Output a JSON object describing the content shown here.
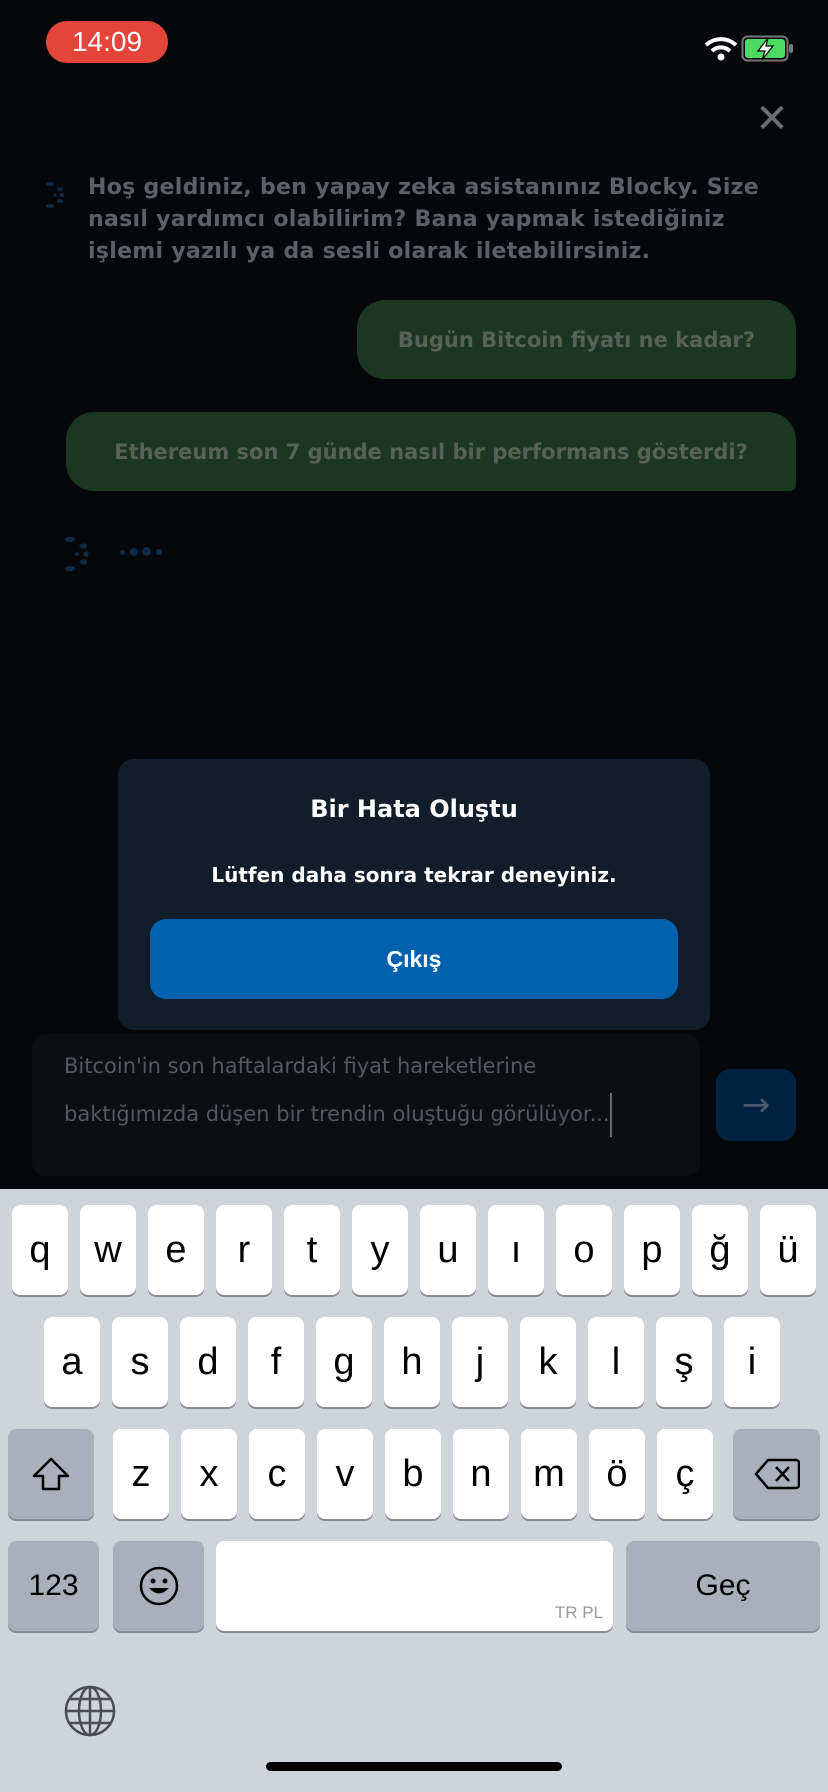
{
  "status_bar": {
    "time": "14:09",
    "wifi_icon": "wifi-icon",
    "battery_icon": "battery-charging-icon",
    "battery_color": "#4cd964"
  },
  "chat": {
    "welcome": "Hoş geldiniz, ben yapay zeka asistanınız Blocky. Size nasıl yardımcı olabilirim? Bana yapmak istediğiniz işlemi yazılı ya da sesli olarak iletebilirsiniz.",
    "messages": [
      "Bugün Bitcoin fiyatı ne kadar?",
      "Ethereum son 7 günde nasıl bir performans gösterdi?"
    ],
    "close_icon": "close-icon"
  },
  "dialog": {
    "title": "Bir Hata Oluştu",
    "message": "Lütfen daha sonra tekrar deneyiniz.",
    "button": "Çıkış"
  },
  "input": {
    "value": "Bitcoin'in son haftalardaki fiyat hareketlerine baktığımızda düşen bir trendin oluştuğu görülüyor...",
    "send_icon": "arrow-right-icon"
  },
  "keyboard": {
    "row1": [
      "q",
      "w",
      "e",
      "r",
      "t",
      "y",
      "u",
      "ı",
      "o",
      "p",
      "ğ",
      "ü"
    ],
    "row2": [
      "a",
      "s",
      "d",
      "f",
      "g",
      "h",
      "j",
      "k",
      "l",
      "ş",
      "i"
    ],
    "row3": [
      "z",
      "x",
      "c",
      "v",
      "b",
      "n",
      "m",
      "ö",
      "ç"
    ],
    "numbers": "123",
    "space_hint": "TR PL",
    "return": "Geç"
  },
  "colors": {
    "accent": "#0461b0",
    "bubble": "#1b3721",
    "dialog": "#121d2b",
    "time_pill": "#e5443a"
  }
}
